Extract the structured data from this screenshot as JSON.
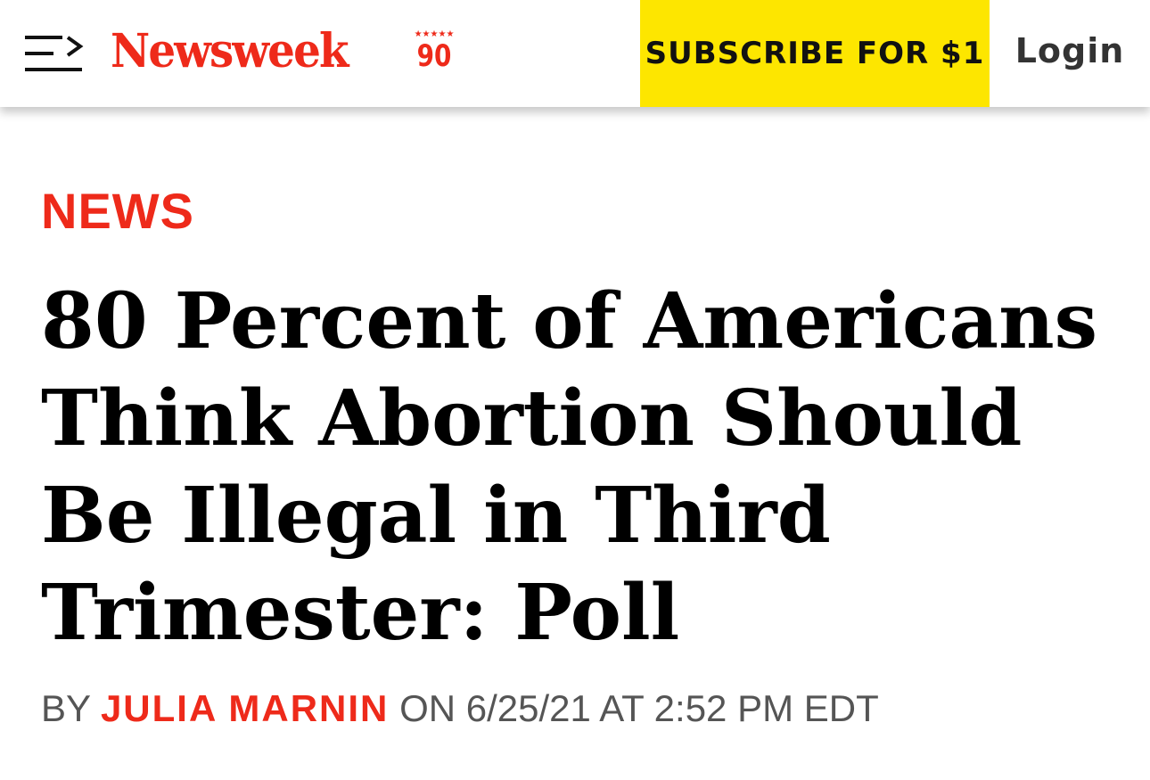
{
  "header": {
    "logo_text": "Newsweek",
    "logo_badge_stars": "★★★★★",
    "logo_badge_number": "90",
    "subscribe_label": "SUBSCRIBE FOR $1",
    "login_label": "Login"
  },
  "article": {
    "category": "NEWS",
    "headline": "80 Percent of Americans Think Abortion Should Be Illegal in Third Trimester: Poll",
    "byline_prefix": "BY",
    "author": "JULIA MARNIN",
    "date_text": "ON 6/25/21 AT 2:52 PM EDT"
  },
  "colors": {
    "brand_red": "#ee2a1a",
    "subscribe_bg": "#fde600",
    "headline": "#000000",
    "byline_gray": "#555555"
  },
  "icons": {
    "menu": "menu-icon",
    "anniversary_badge": "anniversary-90-badge"
  }
}
